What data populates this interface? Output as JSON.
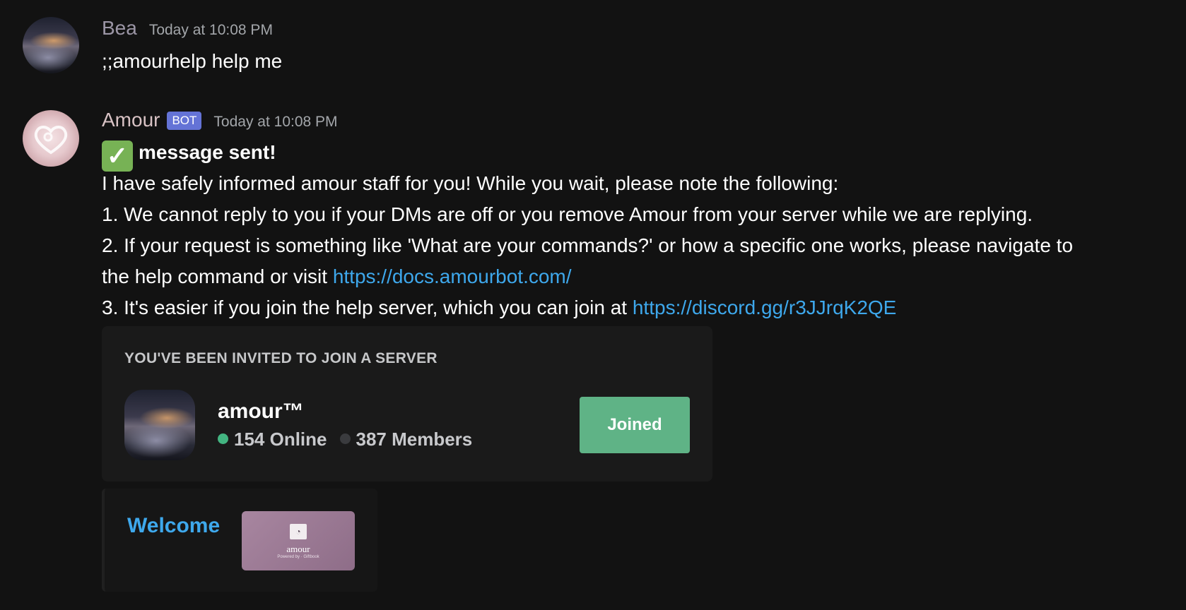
{
  "messages": [
    {
      "author": "Bea",
      "timestamp": "Today at 10:08 PM",
      "content": ";;amourhelp help me"
    },
    {
      "author": "Amour",
      "bot_tag": "BOT",
      "timestamp": "Today at 10:08 PM",
      "heading": "message sent!",
      "heading_emoji": "✓",
      "line1": "I have safely informed amour staff for you! While you wait, please note the following:",
      "line2": "1. We cannot reply to you if your DMs are off or you remove Amour from your server while we are replying.",
      "line3": "2. If your request is something like 'What are your commands?' or how a specific one works, please navigate to",
      "line4_text": "the help command or visit ",
      "line4_link": "https://docs.amourbot.com/",
      "line5_text": "3. It's easier if you join the help server, which you can join at ",
      "line5_link": "https://discord.gg/r3JJrqK2QE"
    }
  ],
  "invite": {
    "label": "YOU'VE BEEN INVITED TO JOIN A SERVER",
    "server_name": "amour™",
    "online": "154 Online",
    "members": "387 Members",
    "button_label": "Joined"
  },
  "embed": {
    "title": "Welcome",
    "thumbnail_text": "amour",
    "thumbnail_sub": "Powered by · Giftbook"
  },
  "colors": {
    "background": "#121212",
    "link": "#3ea8ec",
    "bot_tag": "#6473d6",
    "joined_button": "#5fb386",
    "online_dot": "#43b581"
  }
}
